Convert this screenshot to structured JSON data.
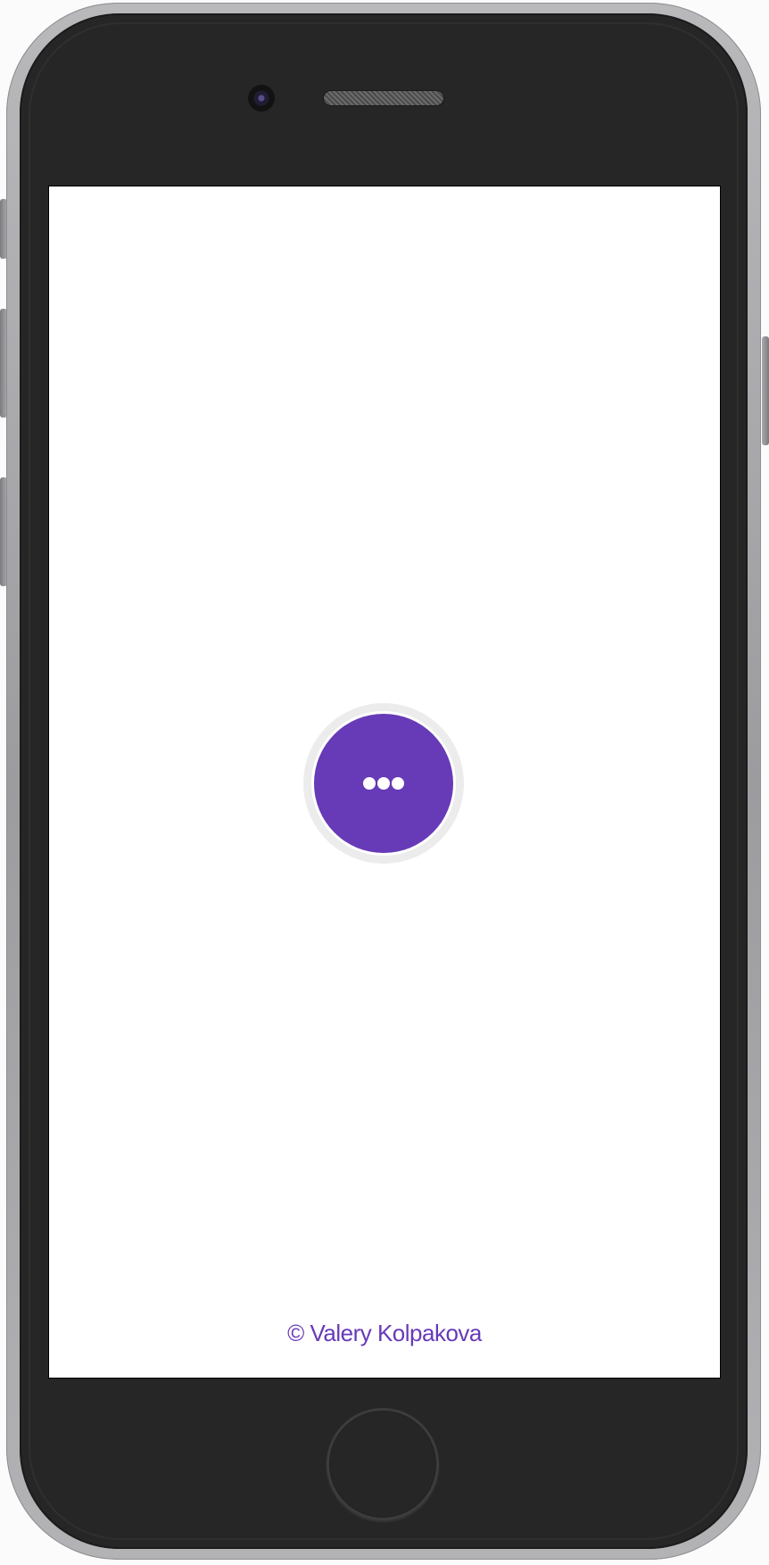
{
  "device": {
    "name": "phone-mockup"
  },
  "app": {
    "fab": {
      "icon": "more-horizontal-icon",
      "color": "#673ab7",
      "ring_color": "#ececec"
    },
    "footer_text": "© Valery Kolpakova",
    "footer_color": "#673ab7"
  }
}
